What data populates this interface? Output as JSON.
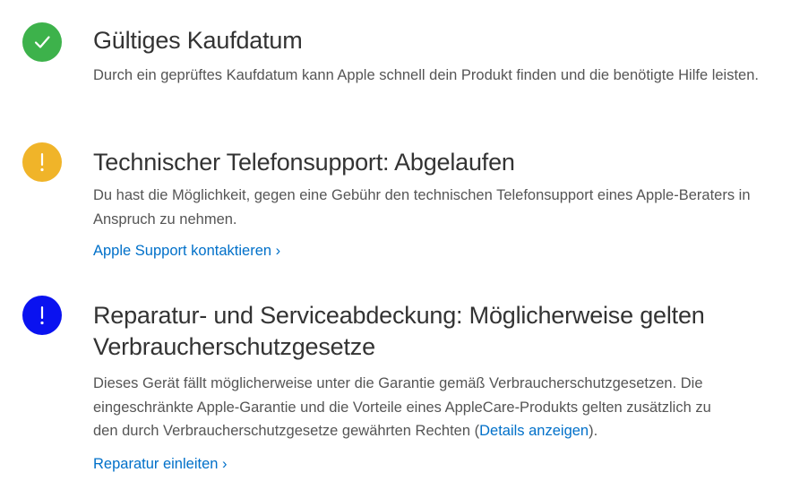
{
  "purchase_date": {
    "title": "Gültiges Kaufdatum",
    "description": "Durch ein geprüftes Kaufdatum kann Apple schnell dein Produkt finden und die benötigte Hilfe leisten.",
    "icon": "checkmark-icon",
    "icon_color": "#3db24b"
  },
  "phone_support": {
    "title": "Technischer Telefonsupport: Abgelaufen",
    "description": "Du hast die Möglichkeit, gegen eine Gebühr den technischen Telefonsupport eines Apple-Beraters in Anspruch zu nehmen.",
    "link_label": "Apple Support kontaktieren ›",
    "icon": "exclamation-icon",
    "icon_color": "#f0b429"
  },
  "repair_coverage": {
    "title_line1": "Reparatur- und Serviceabdeckung: Möglicherweise gelten",
    "title_line2": "Verbraucherschutzgesetze",
    "description_line1": "Dieses Gerät fällt möglicherweise unter die Garantie gemäß Verbraucherschutzgesetzen. Die",
    "description_line2": "eingeschränkte Apple-Garantie und die Vorteile eines AppleCare-Produkts gelten zusätzlich zu",
    "description_line3_prefix": "den durch Verbraucherschutzgesetze gewährten Rechten (",
    "details_link": "Details anzeigen",
    "description_line3_suffix": ").",
    "link_label": "Reparatur einleiten ›",
    "icon": "exclamation-icon",
    "icon_color": "#0a12f0"
  }
}
